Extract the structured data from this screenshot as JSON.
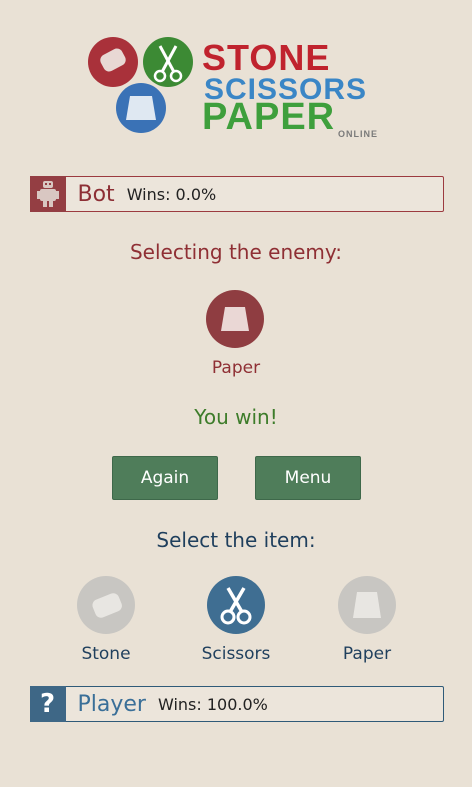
{
  "logo": {
    "line1": "STONE",
    "line2": "SCISSORS",
    "line3": "PAPER",
    "line4": "ONLINE",
    "colors": {
      "stone": "#c0232e",
      "scissors": "#3a86c6",
      "paper": "#3e9f3c"
    }
  },
  "bot": {
    "name": "Bot",
    "wins": "Wins: 0.0%",
    "icon": "robot-icon",
    "color": "#943e43"
  },
  "enemy": {
    "heading": "Selecting the enemy:",
    "choice_label": "Paper",
    "choice_icon": "paper-icon"
  },
  "result": {
    "text": "You win!"
  },
  "buttons": {
    "again": "Again",
    "menu": "Menu"
  },
  "selection": {
    "heading": "Select the item:",
    "items": [
      {
        "label": "Stone",
        "icon": "stone-icon",
        "selected": false
      },
      {
        "label": "Scissors",
        "icon": "scissors-icon",
        "selected": true
      },
      {
        "label": "Paper",
        "icon": "paper-icon",
        "selected": false
      }
    ]
  },
  "player": {
    "name": "Player",
    "wins": "Wins: 100.0%",
    "icon": "question-icon",
    "badge_text": "?",
    "color": "#3e6786"
  }
}
